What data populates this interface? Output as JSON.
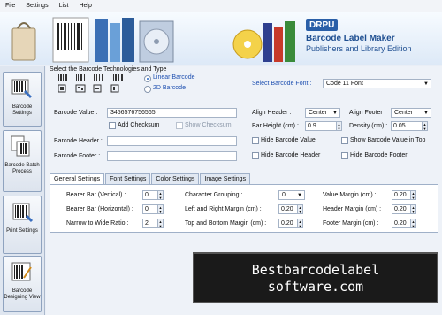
{
  "menu": [
    "File",
    "Settings",
    "List",
    "Help"
  ],
  "brand": {
    "company": "DRPU",
    "product": "Barcode Label Maker",
    "edition": "Publishers and Library Edition"
  },
  "sidebar": [
    {
      "label": "Barcode Settings",
      "icon": "barcode-settings-icon"
    },
    {
      "label": "Barcode Batch Process",
      "icon": "batch-process-icon"
    },
    {
      "label": "Print Settings",
      "icon": "print-settings-icon"
    },
    {
      "label": "Barcode Designing View",
      "icon": "designing-view-icon"
    }
  ],
  "technology": {
    "heading": "Select the Barcode Technologies and Type",
    "linear": "Linear Barcode",
    "twod": "2D Barcode",
    "font_label": "Select Barcode Font :",
    "font_value": "Code 11 Font"
  },
  "fields": {
    "value_label": "Barcode Value :",
    "value": "3456576756565",
    "add_checksum": "Add Checksum",
    "show_checksum": "Show Checksum",
    "header_label": "Barcode Header :",
    "footer_label": "Barcode Footer :",
    "align_header_label": "Align Header :",
    "align_header_value": "Center",
    "align_footer_label": "Align Footer :",
    "align_footer_value": "Center",
    "bar_height_label": "Bar Height (cm) :",
    "bar_height_value": "0.9",
    "density_label": "Density (cm) :",
    "density_value": "0.05",
    "hide_value": "Hide Barcode Value",
    "show_value_top": "Show Barcode Value in Top",
    "hide_header": "Hide Barcode Header",
    "hide_footer": "Hide Barcode Footer"
  },
  "tabs": [
    "General Settings",
    "Font Settings",
    "Color Settings",
    "Image Settings"
  ],
  "general": {
    "bearer_v_label": "Bearer Bar (Vertical) :",
    "bearer_v": "0",
    "bearer_h_label": "Bearer Bar (Horizontal) :",
    "bearer_h": "0",
    "narrow_label": "Narrow to Wide Ratio :",
    "narrow": "2",
    "char_group_label": "Character Grouping :",
    "char_group": "0",
    "lr_margin_label": "Left and Right Margin (cm) :",
    "lr_margin": "0.20",
    "tb_margin_label": "Top and Bottom Margin (cm) :",
    "tb_margin": "0.20",
    "value_margin_label": "Value Margin (cm) :",
    "value_margin": "0.20",
    "header_margin_label": "Header Margin (cm) :",
    "header_margin": "0.20",
    "footer_margin_label": "Footer Margin (cm) :",
    "footer_margin": "0.20"
  },
  "watermark": {
    "line1": "Bestbarcodelabel",
    "line2": "software.com"
  }
}
